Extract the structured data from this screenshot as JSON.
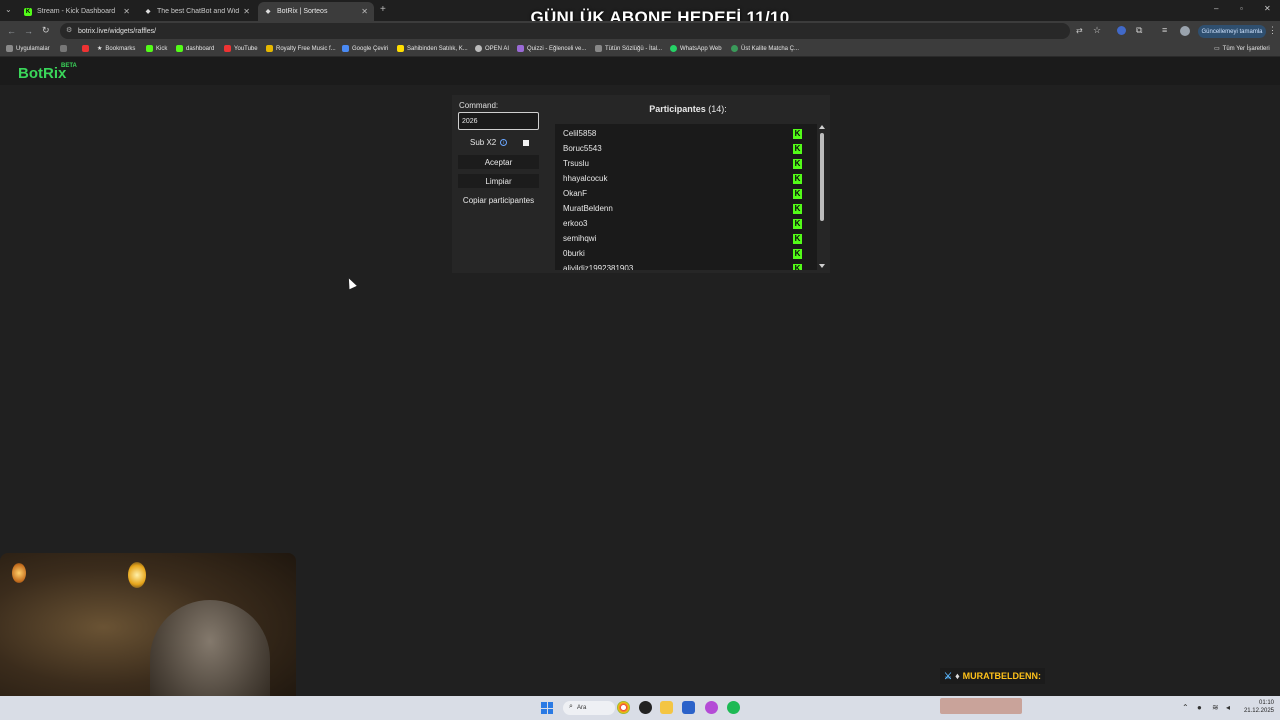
{
  "overlay": {
    "title": "GÜNLÜK ABONE HEDEFİ 11/10"
  },
  "browser": {
    "tabs": [
      {
        "label": "Stream - Kick Dashboard",
        "favicon": "K",
        "active": false
      },
      {
        "label": "The best ChatBot and Widgets",
        "favicon": "◆",
        "active": false
      },
      {
        "label": "BotRix | Sorteos",
        "favicon": "◆",
        "active": true
      }
    ],
    "url": "botrix.live/widgets/raffles/",
    "update_button": "Güncellemeyi tamamla",
    "bookmarks": [
      "Uygulamalar",
      "Bookmarks",
      "Kick",
      "dashboard",
      "YouTube",
      "Royalty Free Music f...",
      "Google Çeviri",
      "Sahibinden Satılık, K...",
      "OPEN AI",
      "Quizzi - Eğlenceli ve...",
      "Tütün Sözlüğü - İtal...",
      "WhatsApp Web",
      "Üst Kalite Matcha Ç..."
    ],
    "all_bookmarks": "Tüm Yer İşaretleri"
  },
  "site": {
    "logo": "BotRix",
    "logo_badge": "BETA"
  },
  "widget": {
    "command_label": "Command:",
    "command_value": "2026",
    "sub_label": "Sub X2",
    "accept_label": "Aceptar",
    "clear_label": "Limpiar",
    "copy_label": "Copiar participantes",
    "participants_title": "Participantes",
    "participants_count": "(14)",
    "participants_suffix": ":",
    "participants": [
      "Celil5858",
      "Boruc5543",
      "Trsuslu",
      "hhayalcocuk",
      "OkanF",
      "MuratBeldenn",
      "erkoo3",
      "semihqwi",
      "0burki",
      "aliyildiz1992381903"
    ]
  },
  "chat": {
    "message": "MURATBELDENN:"
  },
  "taskbar": {
    "search_placeholder": "Ara",
    "time": "01:10",
    "date": "21.12.2025"
  },
  "colors": {
    "accent": "#3ad65a",
    "kick": "#53fc18"
  }
}
